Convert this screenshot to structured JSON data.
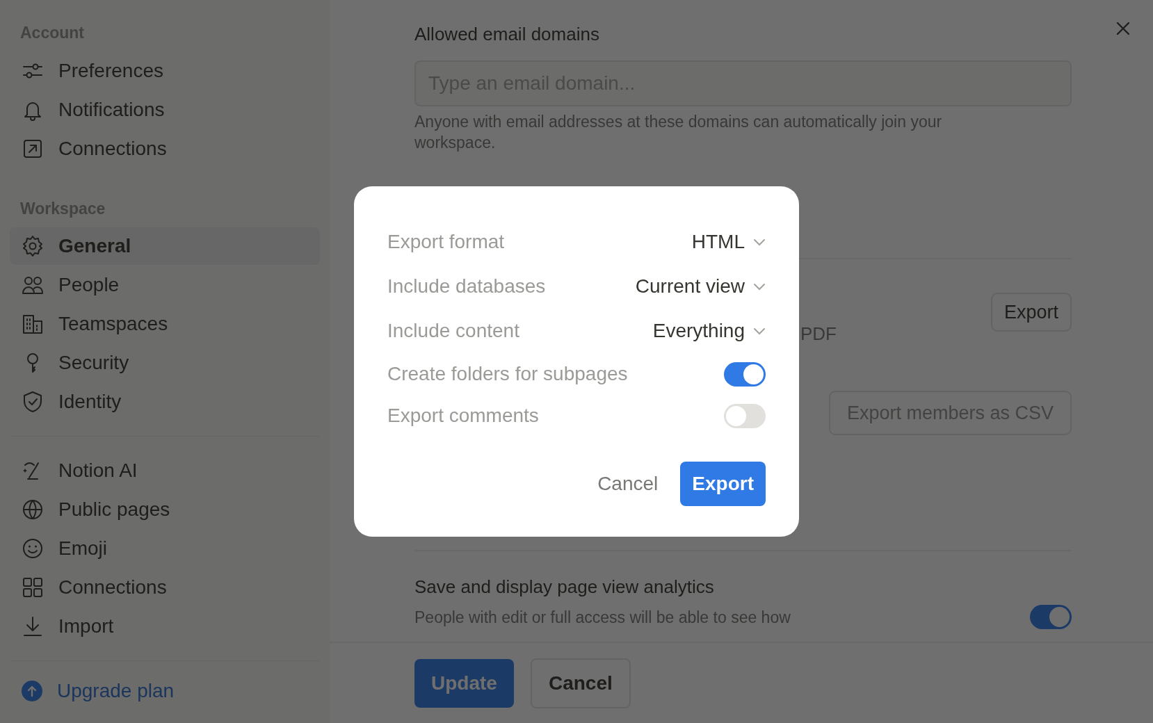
{
  "sidebar": {
    "sections": [
      {
        "label": "Account",
        "items": [
          {
            "label": "Preferences",
            "selected": false
          },
          {
            "label": "Notifications",
            "selected": false
          },
          {
            "label": "Connections",
            "selected": false
          }
        ]
      },
      {
        "label": "Workspace",
        "items": [
          {
            "label": "General",
            "selected": true
          },
          {
            "label": "People",
            "selected": false
          },
          {
            "label": "Teamspaces",
            "selected": false
          },
          {
            "label": "Security",
            "selected": false
          },
          {
            "label": "Identity",
            "selected": false
          }
        ]
      },
      {
        "items": [
          {
            "label": "Notion AI",
            "selected": false
          },
          {
            "label": "Public pages",
            "selected": false
          },
          {
            "label": "Emoji",
            "selected": false
          },
          {
            "label": "Connections",
            "selected": false
          },
          {
            "label": "Import",
            "selected": false
          }
        ]
      }
    ],
    "upgrade": "Upgrade plan"
  },
  "content": {
    "email_domains": {
      "title": "Allowed email domains",
      "placeholder": "Type an email domain...",
      "help": "Anyone with email addresses at these domains can automatically join your workspace."
    },
    "export_partial_text": "PDF",
    "export_button": "Export",
    "export_members_button": "Export members as CSV",
    "analytics": {
      "title": "Save and display page view analytics",
      "description": "People with edit or full access will be able to see how",
      "on": true
    },
    "footer_buttons": [
      "Update",
      "Cancel"
    ]
  },
  "dialog": {
    "rows": [
      {
        "kind": "dropdown",
        "label": "Export format",
        "value": "HTML"
      },
      {
        "kind": "dropdown",
        "label": "Include databases",
        "value": "Current view"
      },
      {
        "kind": "dropdown",
        "label": "Include content",
        "value": "Everything"
      },
      {
        "kind": "toggle",
        "label": "Create folders for subpages",
        "on": true
      },
      {
        "kind": "toggle",
        "label": "Export comments",
        "on": false
      }
    ],
    "cancel": "Cancel",
    "confirm": "Export"
  }
}
